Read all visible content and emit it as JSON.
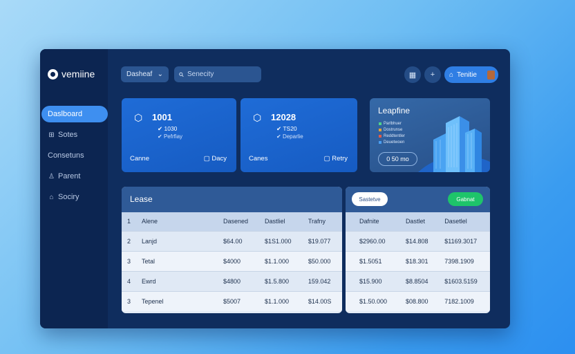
{
  "app": {
    "name": "vemiine"
  },
  "sidebar": {
    "items": [
      {
        "label": "Daslboard",
        "icon": "",
        "active": true
      },
      {
        "label": "Sotes",
        "icon": "grid-icon"
      },
      {
        "label": "Consetuns",
        "icon": ""
      },
      {
        "label": "Parent",
        "icon": "person-icon"
      },
      {
        "label": "Sociry",
        "icon": "bank-icon"
      }
    ]
  },
  "topbar": {
    "select_value": "Dasheaf",
    "search_placeholder": "Senecity",
    "user_label": "Tenitie"
  },
  "cards": [
    {
      "value": "1001",
      "line1": "1030",
      "line2": "Pefrfiay",
      "foot_left": "Canne",
      "foot_right": "Dacy"
    },
    {
      "value": "12028",
      "line1": "TS20",
      "line2": "Deparlie",
      "foot_left": "Canes",
      "foot_right": "Retry"
    }
  ],
  "summary_card": {
    "title": "Leapfine",
    "legend": [
      {
        "label": "Parlbhuer",
        "color": "#4fd18b"
      },
      {
        "label": "Dostrunse",
        "color": "#e0a23a"
      },
      {
        "label": "Reddtentler",
        "color": "#e05a4a"
      },
      {
        "label": "Deuetwoen",
        "color": "#4a9ef0"
      }
    ],
    "pill": "0 50 mo"
  },
  "lease_table": {
    "title": "Lease",
    "headers": [
      "1",
      "Alene",
      "Dasened",
      "Dastliel",
      "Trafny"
    ],
    "rows": [
      [
        "2",
        "Lanjd",
        "$64.00",
        "$1S1.000",
        "$19.077"
      ],
      [
        "3",
        "Tetal",
        "$4000",
        "$1.1.000",
        "$50.000"
      ],
      [
        "4",
        "Ewrd",
        "$4800",
        "$1.5.800",
        "159.042"
      ],
      [
        "3",
        "Tepenel",
        "$5007",
        "$1.1.000",
        "$14.00S"
      ]
    ]
  },
  "right_table": {
    "btn_left": "Sastetve",
    "btn_right": "Gabnat",
    "headers": [
      "Dafnite",
      "Dastlet",
      "Dasetlel"
    ],
    "rows": [
      [
        "$2960.00",
        "$14.808",
        "$1169.3017"
      ],
      [
        "$1.5051",
        "$18.301",
        "7398.1909"
      ],
      [
        "$15.900",
        "$8.8504",
        "$1603.5159"
      ],
      [
        "$1.50.000",
        "$08.800",
        "7182.1009"
      ]
    ]
  }
}
